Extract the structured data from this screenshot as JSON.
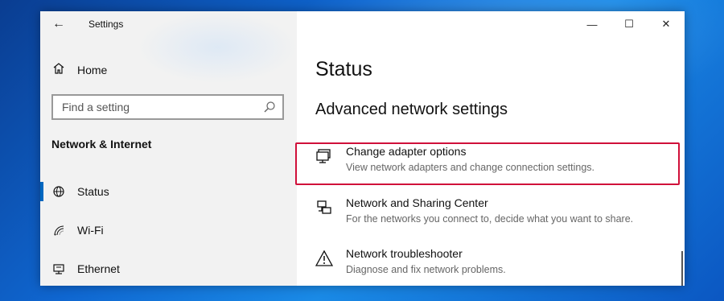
{
  "window": {
    "app_title": "Settings",
    "controls": {
      "minimize": "—",
      "maximize": "☐",
      "close": "✕"
    }
  },
  "sidebar": {
    "home_label": "Home",
    "search": {
      "placeholder": "Find a setting",
      "value": ""
    },
    "section_heading": "Network & Internet",
    "items": [
      {
        "label": "Status",
        "icon": "globe-icon",
        "active": true
      },
      {
        "label": "Wi-Fi",
        "icon": "wifi-icon",
        "active": false
      },
      {
        "label": "Ethernet",
        "icon": "ethernet-icon",
        "active": false
      }
    ]
  },
  "content": {
    "page_title": "Status",
    "sub_heading": "Advanced network settings",
    "links": [
      {
        "title": "Change adapter options",
        "description": "View network adapters and change connection settings.",
        "icon": "network-adapter-icon",
        "highlighted": true
      },
      {
        "title": "Network and Sharing Center",
        "description": "For the networks you connect to, decide what you want to share.",
        "icon": "sharing-center-icon",
        "highlighted": false
      },
      {
        "title": "Network troubleshooter",
        "description": "Diagnose and fix network problems.",
        "icon": "warning-icon",
        "highlighted": false
      }
    ]
  },
  "colors": {
    "accent": "#0067c0",
    "highlight_border": "#d0103a",
    "sidebar_bg": "#f2f2f2"
  }
}
